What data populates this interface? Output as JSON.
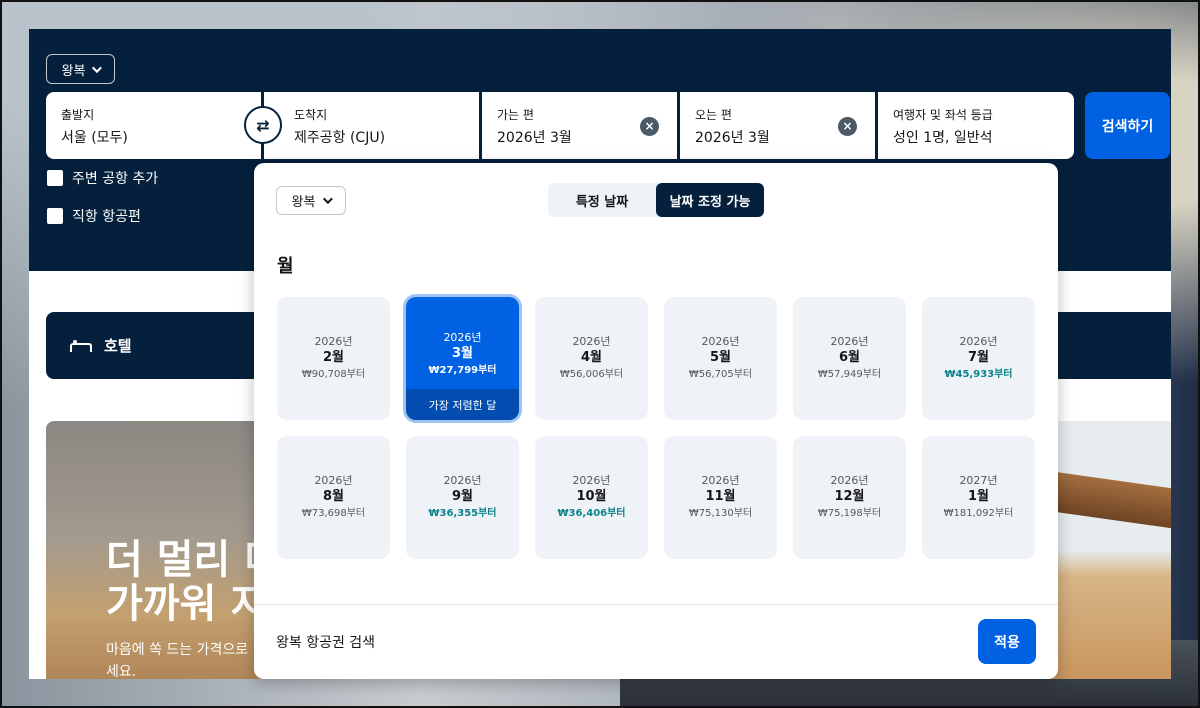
{
  "search": {
    "trip_type": "왕복",
    "from": {
      "label": "출발지",
      "value": "서울 (모두)"
    },
    "to": {
      "label": "도착지",
      "value": "제주공항 (CJU)"
    },
    "depart": {
      "label": "가는 편",
      "value": "2026년 3월"
    },
    "return": {
      "label": "오는 편",
      "value": "2026년 3월"
    },
    "travelers": {
      "label": "여행자 및 좌석 등급",
      "value": "성인 1명, 일반석"
    },
    "search_label": "검색하기",
    "nearby_airports": "주변 공항 추가",
    "direct_flights": "직항 항공편"
  },
  "hotel": {
    "label": "호텔"
  },
  "hero": {
    "title_line1": "더 멀리 더",
    "title_line2": "가까워 지",
    "subtitle": "마음에 쏙 드는 가격으로 세요."
  },
  "popup": {
    "trip_type": "왕복",
    "toggle": {
      "specific": "특정 날짜",
      "flexible": "날짜 조정 가능"
    },
    "month_heading": "월",
    "months": [
      {
        "year": "2026년",
        "month": "2월",
        "price": "₩90,708부터"
      },
      {
        "year": "2026년",
        "month": "3월",
        "price": "₩27,799부터",
        "badge": "가장 저렴한 달"
      },
      {
        "year": "2026년",
        "month": "4월",
        "price": "₩56,006부터"
      },
      {
        "year": "2026년",
        "month": "5월",
        "price": "₩56,705부터"
      },
      {
        "year": "2026년",
        "month": "6월",
        "price": "₩57,949부터"
      },
      {
        "year": "2026년",
        "month": "7월",
        "price": "₩45,933부터"
      },
      {
        "year": "2026년",
        "month": "8월",
        "price": "₩73,698부터"
      },
      {
        "year": "2026년",
        "month": "9월",
        "price": "₩36,355부터"
      },
      {
        "year": "2026년",
        "month": "10월",
        "price": "₩36,406부터"
      },
      {
        "year": "2026년",
        "month": "11월",
        "price": "₩75,130부터"
      },
      {
        "year": "2026년",
        "month": "12월",
        "price": "₩75,198부터"
      },
      {
        "year": "2027년",
        "month": "1월",
        "price": "₩181,092부터"
      }
    ],
    "footer_text": "왕복 항공권 검색",
    "apply_label": "적용"
  },
  "colors": {
    "navy": "#05203c",
    "primary": "#0062e3",
    "cheap_price": "#0c838a"
  }
}
